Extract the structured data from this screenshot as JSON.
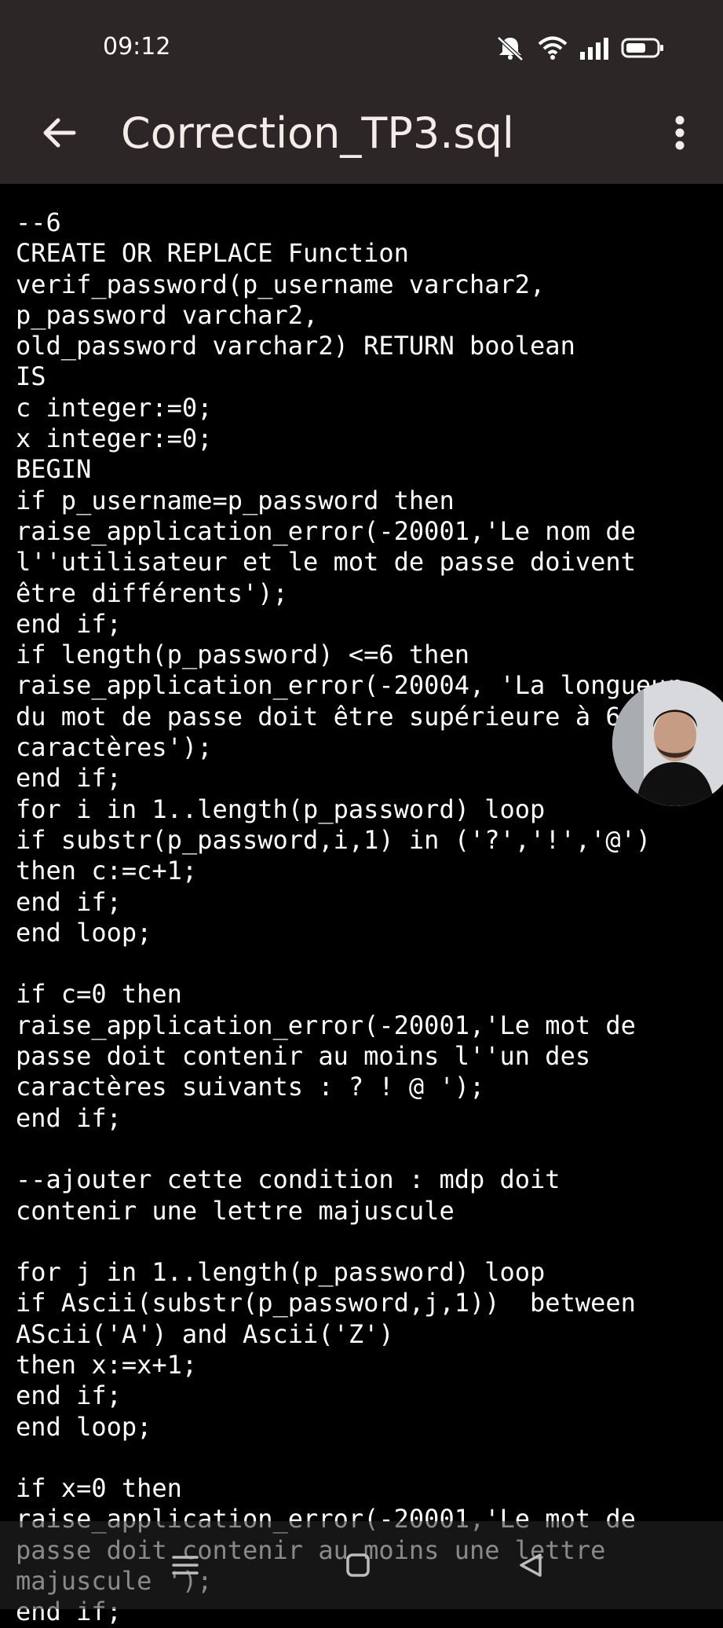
{
  "status_bar": {
    "time": "09:12",
    "icons": [
      "mute-icon",
      "wifi-icon",
      "signal-icon",
      "battery-icon"
    ]
  },
  "app_bar": {
    "back_icon": "arrow-left-icon",
    "title": "Correction_TP3.sql",
    "menu_icon": "more-vert-icon"
  },
  "code_lines": [
    "--6",
    "CREATE OR REPLACE Function",
    "verif_password(p_username varchar2,",
    "p_password varchar2,",
    "old_password varchar2) RETURN boolean",
    "IS",
    "c integer:=0;",
    "x integer:=0;",
    "BEGIN",
    "if p_username=p_password then",
    "raise_application_error(-20001,'Le nom de",
    "l''utilisateur et le mot de passe doivent",
    "être différents');",
    "end if;",
    "if length(p_password) <=6 then",
    "raise_application_error(-20004, 'La longueur",
    "du mot de passe doit être supérieure à 6",
    "caractères');",
    "end if;",
    "for i in 1..length(p_password) loop",
    "if substr(p_password,i,1) in ('?','!','@')",
    "then c:=c+1;",
    "end if;",
    "end loop;",
    "",
    "if c=0 then",
    "raise_application_error(-20001,'Le mot de",
    "passe doit contenir au moins l''un des",
    "caractères suivants : ? ! @ ');",
    "end if;",
    "",
    "--ajouter cette condition : mdp doit",
    "contenir une lettre majuscule",
    "",
    "for j in 1..length(p_password) loop",
    "if Ascii(substr(p_password,j,1))  between",
    "AScii('A') and Ascii('Z')",
    "then x:=x+1;",
    "end if;",
    "end loop;",
    "",
    "if x=0 then",
    "raise_application_error(-20001,'Le mot de",
    "passe doit contenir au moins une lettre",
    "majuscule ');",
    "end if;"
  ],
  "nav_bar": {
    "icons": [
      "menu-icon",
      "home-square-icon",
      "back-triangle-icon"
    ]
  }
}
